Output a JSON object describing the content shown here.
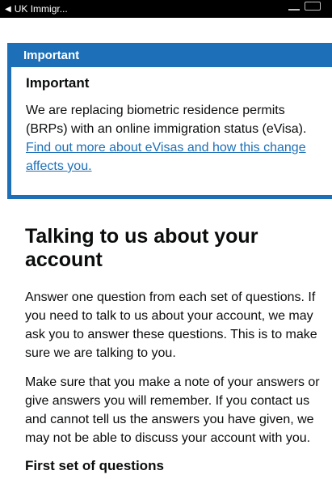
{
  "status_bar": {
    "back_label": "UK Immigr..."
  },
  "banner": {
    "header": "Important",
    "title": "Important",
    "text": "We are replacing biometric residence permits (BRPs) with an online immigration status (eVisa).",
    "link_text": "Find out more about eVisas and how this change affects you."
  },
  "main": {
    "title": "Talking to us about your account",
    "paragraph_1": "Answer one question from each set of questions. If you need to talk to us about your account, we may ask you to answer these questions. This is to make sure we are talking to you.",
    "paragraph_2": "Make sure that you make a note of your answers or give answers you will remember. If you contact us and cannot tell us the answers you have given, we may not be able to discuss your account with you.",
    "subheading": "First set of questions"
  },
  "colors": {
    "accent_blue": "#1d70b8",
    "text": "#0b0c0c"
  }
}
